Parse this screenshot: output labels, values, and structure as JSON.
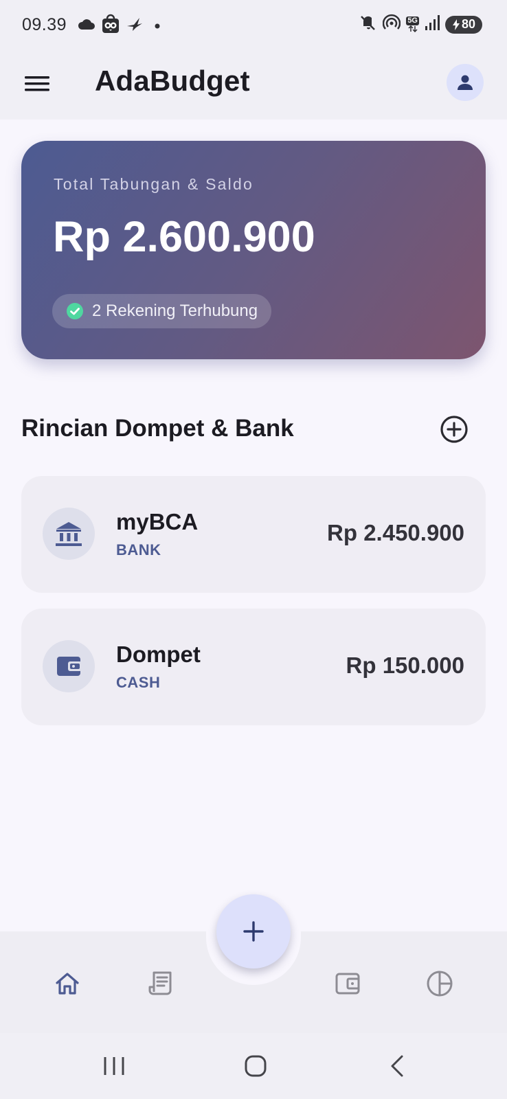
{
  "status_bar": {
    "time": "09.39",
    "network": "5G",
    "battery": "80",
    "icons": [
      "cloud-icon",
      "tokopedia-icon",
      "bird-icon",
      "dot-icon",
      "mute-icon",
      "hotspot-icon",
      "signal-icon",
      "battery-charging-icon"
    ]
  },
  "app_bar": {
    "title": "AdaBudget",
    "icons": [
      "menu-icon",
      "account-icon"
    ]
  },
  "balance_card": {
    "label": "Total Tabungan & Saldo",
    "amount": "Rp 2.600.900",
    "linked_text": "2 Rekening Terhubung",
    "colors": {
      "start": "#4d5b92",
      "end": "#7d556f",
      "check": "#4fd7a0"
    }
  },
  "section": {
    "title": "Rincian Dompet & Bank",
    "add_icon": "add-circle-icon"
  },
  "accounts": [
    {
      "name": "myBCA",
      "type": "BANK",
      "balance": "Rp 2.450.900",
      "icon": "bank-icon"
    },
    {
      "name": "Dompet",
      "type": "CASH",
      "balance": "Rp 150.000",
      "icon": "wallet-icon"
    }
  ],
  "bottom_nav": {
    "items": [
      {
        "icon": "home-icon",
        "active": true
      },
      {
        "icon": "receipt-icon",
        "active": false
      },
      {
        "icon": "wallet-icon",
        "active": false
      },
      {
        "icon": "pie-chart-icon",
        "active": false
      }
    ],
    "fab_icon": "plus-icon",
    "colors": {
      "active": "#4d5b92",
      "inactive": "#8d8c93",
      "fab": "#dde0fb"
    }
  },
  "system_nav": {
    "icons": [
      "recents-icon",
      "home-icon",
      "back-icon"
    ]
  }
}
